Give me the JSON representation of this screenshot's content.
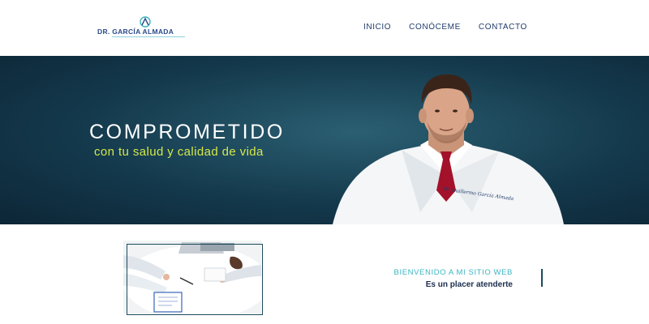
{
  "brand": {
    "name": "DR. GARCÍA ALMADA"
  },
  "nav": {
    "items": [
      "INICIO",
      "CONÓCEME",
      "CONTACTO"
    ]
  },
  "hero": {
    "title": "COMPROMETIDO",
    "subtitle": "con tu salud y calidad de vida",
    "coat_embroidery": "Dr. Guillermo García Almada"
  },
  "welcome": {
    "title": "BIENVENIDO A MI SITIO WEB",
    "subtitle": "Es un placer atenderte"
  },
  "colors": {
    "navy": "#1f3a6b",
    "hero_bg": "#14394c",
    "accent_lime": "#d4e84a",
    "accent_teal": "#3bb5c3"
  }
}
